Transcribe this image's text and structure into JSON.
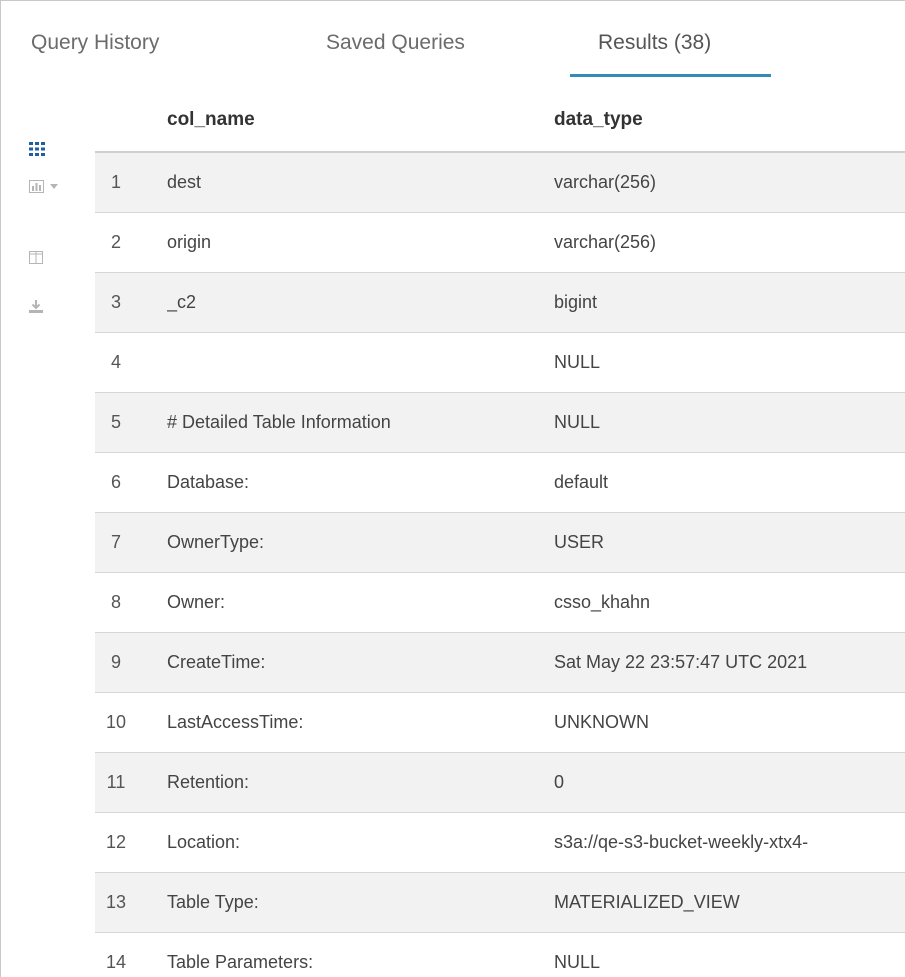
{
  "tabs": [
    {
      "label": "Query History",
      "active": false
    },
    {
      "label": "Saved Queries",
      "active": false
    },
    {
      "label": "Results (38)",
      "active": true
    }
  ],
  "colors": {
    "accent": "#338bb8",
    "active_icon": "#1f5f9e",
    "muted_icon": "#b5b5b5",
    "stripe": "#f2f2f2"
  },
  "toolbar": {
    "icons": [
      "grid-icon",
      "bar-chart-icon",
      "chevron-down-icon",
      "columns-icon",
      "download-icon"
    ]
  },
  "table": {
    "columns": [
      "",
      "col_name",
      "data_type"
    ],
    "rows": [
      {
        "idx": "1",
        "col_name": "dest",
        "data_type": "varchar(256)"
      },
      {
        "idx": "2",
        "col_name": "origin",
        "data_type": "varchar(256)"
      },
      {
        "idx": "3",
        "col_name": "_c2",
        "data_type": "bigint"
      },
      {
        "idx": "4",
        "col_name": "",
        "data_type": "NULL"
      },
      {
        "idx": "5",
        "col_name": "# Detailed Table Information",
        "data_type": "NULL"
      },
      {
        "idx": "6",
        "col_name": "Database:",
        "data_type": "default"
      },
      {
        "idx": "7",
        "col_name": "OwnerType:",
        "data_type": "USER"
      },
      {
        "idx": "8",
        "col_name": "Owner:",
        "data_type": "csso_khahn"
      },
      {
        "idx": "9",
        "col_name": "CreateTime:",
        "data_type": "Sat May 22 23:57:47 UTC 2021"
      },
      {
        "idx": "10",
        "col_name": "LastAccessTime:",
        "data_type": "UNKNOWN"
      },
      {
        "idx": "11",
        "col_name": "Retention:",
        "data_type": "0"
      },
      {
        "idx": "12",
        "col_name": "Location:",
        "data_type": "s3a://qe-s3-bucket-weekly-xtx4-"
      },
      {
        "idx": "13",
        "col_name": "Table Type:",
        "data_type": "MATERIALIZED_VIEW"
      },
      {
        "idx": "14",
        "col_name": "Table Parameters:",
        "data_type": "NULL"
      }
    ]
  }
}
